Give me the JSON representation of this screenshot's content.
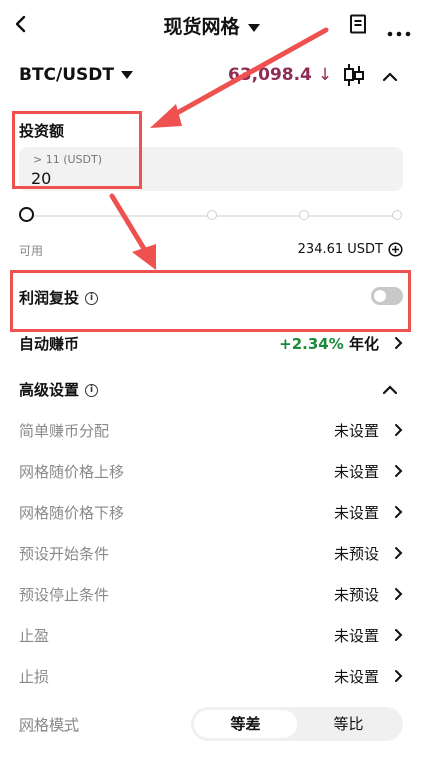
{
  "header": {
    "title": "现货网格",
    "icons": {
      "back": "back-arrow-icon",
      "orders": "orders-list-icon",
      "more": "more-icon"
    }
  },
  "pair": {
    "name": "BTC/USDT",
    "price": "63,098.4",
    "price_direction": "down",
    "price_color": "#8e2d55",
    "icons": {
      "chart": "candlestick-icon",
      "collapse": "chevron-up-icon"
    }
  },
  "investment": {
    "label": "投资额",
    "hint": "> 11 (USDT)",
    "value": "20"
  },
  "slider": {
    "level_fraction": 0
  },
  "available": {
    "label": "可用",
    "value": "234.61 USDT"
  },
  "profit_reinvest": {
    "label": "利润复投",
    "enabled": false
  },
  "auto_earn": {
    "label": "自动赚币",
    "rate": "+2.34%",
    "rate_suffix": "年化",
    "rate_color": "#1a8a3a"
  },
  "advanced": {
    "label": "高级设置",
    "rows": [
      {
        "label": "简单赚币分配",
        "value": "未设置"
      },
      {
        "label": "网格随价格上移",
        "value": "未设置"
      },
      {
        "label": "网格随价格下移",
        "value": "未设置"
      },
      {
        "label": "预设开始条件",
        "value": "未预设"
      },
      {
        "label": "预设停止条件",
        "value": "未预设"
      },
      {
        "label": "止盈",
        "value": "未设置"
      },
      {
        "label": "止损",
        "value": "未设置"
      }
    ]
  },
  "grid_mode": {
    "label": "网格模式",
    "options": [
      "等差",
      "等比"
    ],
    "selected": "等差"
  },
  "accent": "#ef5050"
}
